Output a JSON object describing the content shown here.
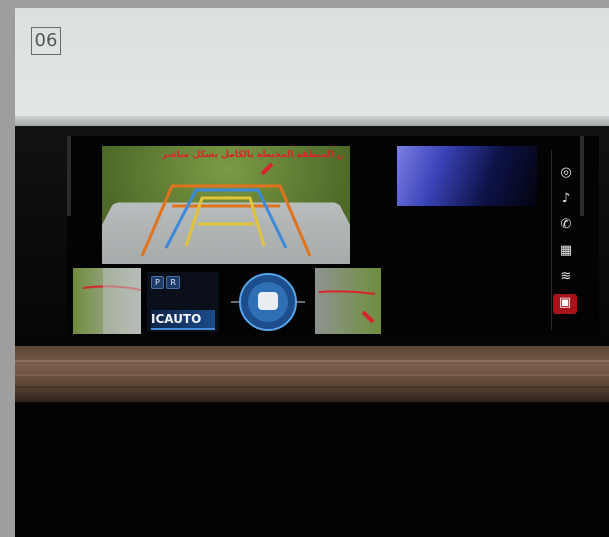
{
  "page": {
    "number": "06"
  },
  "display": {
    "camera_caption": "افحص المنطقة المحيطة بالكامل بشكل مباشر",
    "status_tags": [
      "P",
      "R"
    ],
    "status_value": "ICAUTO",
    "icons": [
      {
        "name": "navigation-icon",
        "glyph": "◎"
      },
      {
        "name": "music-icon",
        "glyph": "♪"
      },
      {
        "name": "phone-icon",
        "glyph": "✆"
      },
      {
        "name": "apps-icon",
        "glyph": "▦"
      },
      {
        "name": "climate-icon",
        "glyph": "≋"
      },
      {
        "name": "camera-icon",
        "glyph": "▣"
      }
    ],
    "active_icon_index": 5
  },
  "colors": {
    "accent_red": "#a7121b",
    "guide_orange": "#e2731d",
    "guide_blue": "#3c8ad9",
    "guide_yellow": "#e2c43a"
  }
}
